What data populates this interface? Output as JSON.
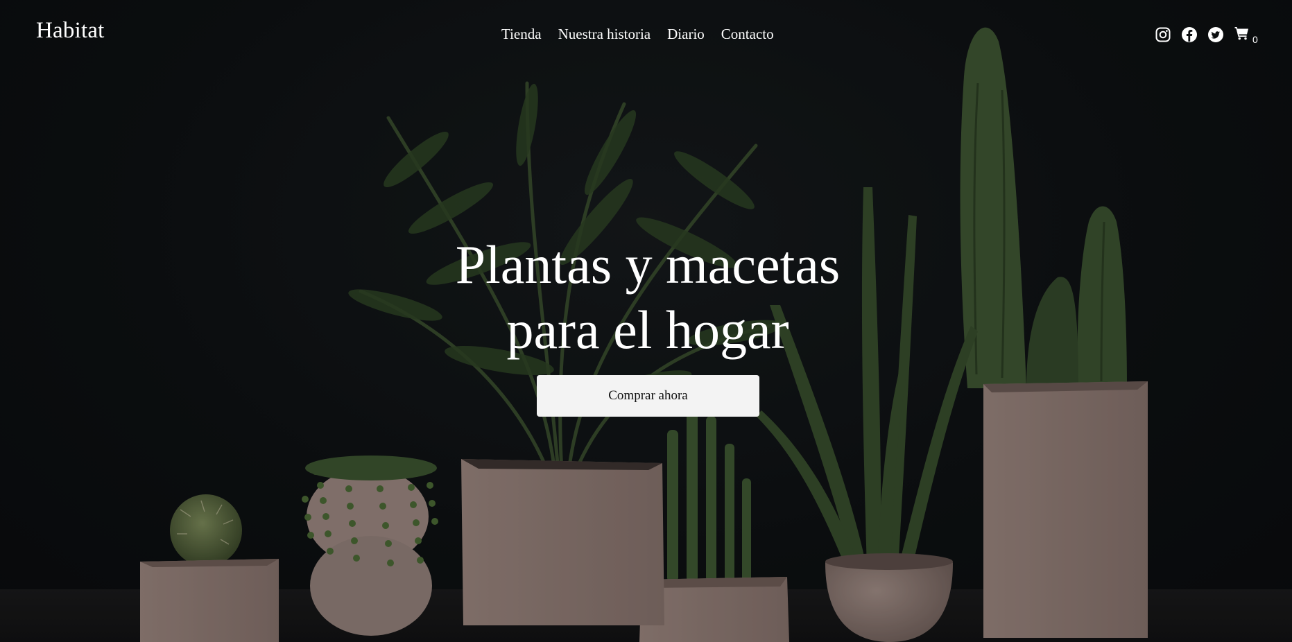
{
  "header": {
    "logo": "Habitat",
    "nav": [
      "Tienda",
      "Nuestra historia",
      "Diario",
      "Contacto"
    ],
    "icons": [
      "instagram-icon",
      "facebook-icon",
      "twitter-icon",
      "cart-icon"
    ],
    "cart_count": "0"
  },
  "hero": {
    "headline_line1": "Plantas y macetas",
    "headline_line2": "para el hogar",
    "cta_label": "Comprar ahora"
  },
  "colors": {
    "background": "#0c0e10",
    "text": "#ffffff",
    "button": "#f3f3f3",
    "pot": "#8b7670"
  }
}
